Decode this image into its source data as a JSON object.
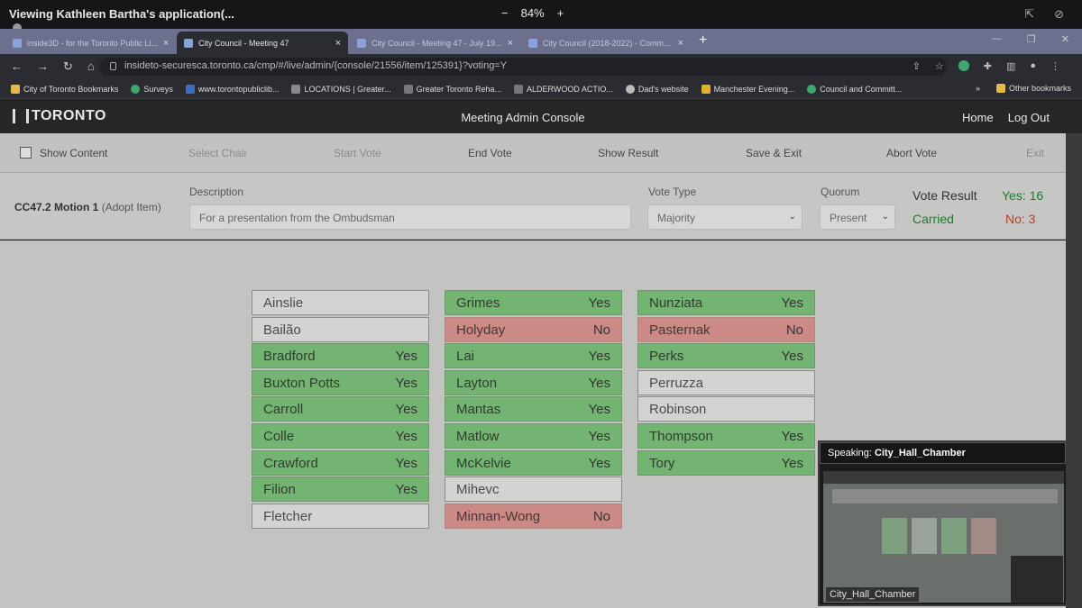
{
  "share": {
    "title": "Viewing Kathleen Bartha's application(...",
    "zoom": "84%",
    "zoom_minus": "−",
    "zoom_plus": "+"
  },
  "tabs": [
    {
      "label": "inside3D - for the Toronto Public Li...",
      "active": false
    },
    {
      "label": "City Council - Meeting 47",
      "active": true
    },
    {
      "label": "City Council - Meeting 47 - July 19...",
      "active": false
    },
    {
      "label": "City Council (2018-2022) - Comm...",
      "active": false
    }
  ],
  "browser": {
    "url": "insideto-securesca.toronto.ca/cmp/#/live/admin/{console/21556/item/125391}?voting=Y",
    "bookmarks": [
      "City of Toronto Bookmarks",
      "Surveys",
      "www.torontopubliclib...",
      "LOCATIONS | Greater...",
      "Greater Toronto Reha...",
      "ALDERWOOD ACTIO...",
      "Dad's website",
      "Manchester Evening...",
      "Council and Committ..."
    ],
    "other_bookmarks": "Other bookmarks",
    "more_bookmarks": "»"
  },
  "header": {
    "logo": "TORONTO",
    "title": "Meeting Admin Console",
    "home": "Home",
    "logout": "Log Out"
  },
  "toolbar": {
    "show_content": "Show Content",
    "select_chair": "Select Chair",
    "start_vote": "Start Vote",
    "end_vote": "End Vote",
    "show_result": "Show Result",
    "save_exit": "Save & Exit",
    "abort_vote": "Abort Vote",
    "exit": "Exit"
  },
  "motion": {
    "id": "CC47.2 Motion 1",
    "sub": "(Adopt Item)",
    "description_label": "Description",
    "description_value": "For a presentation from the Ombudsman",
    "vote_type_label": "Vote Type",
    "vote_type_value": "Majority",
    "quorum_label": "Quorum",
    "quorum_value": "Present",
    "result_label": "Vote Result",
    "result_status": "Carried",
    "yes_count": "Yes: 16",
    "no_count": "No: 3"
  },
  "votes": [
    [
      {
        "name": "Ainslie",
        "vote": ""
      },
      {
        "name": "Bailão",
        "vote": ""
      },
      {
        "name": "Bradford",
        "vote": "Yes"
      },
      {
        "name": "Buxton Potts",
        "vote": "Yes"
      },
      {
        "name": "Carroll",
        "vote": "Yes"
      },
      {
        "name": "Colle",
        "vote": "Yes"
      },
      {
        "name": "Crawford",
        "vote": "Yes"
      },
      {
        "name": "Filion",
        "vote": "Yes"
      },
      {
        "name": "Fletcher",
        "vote": ""
      }
    ],
    [
      {
        "name": "Grimes",
        "vote": "Yes"
      },
      {
        "name": "Holyday",
        "vote": "No"
      },
      {
        "name": "Lai",
        "vote": "Yes"
      },
      {
        "name": "Layton",
        "vote": "Yes"
      },
      {
        "name": "Mantas",
        "vote": "Yes"
      },
      {
        "name": "Matlow",
        "vote": "Yes"
      },
      {
        "name": "McKelvie",
        "vote": "Yes"
      },
      {
        "name": "Mihevc",
        "vote": ""
      },
      {
        "name": "Minnan-Wong",
        "vote": "No"
      }
    ],
    [
      {
        "name": "Nunziata",
        "vote": "Yes"
      },
      {
        "name": "Pasternak",
        "vote": "No"
      },
      {
        "name": "Perks",
        "vote": "Yes"
      },
      {
        "name": "Perruzza",
        "vote": ""
      },
      {
        "name": "Robinson",
        "vote": ""
      },
      {
        "name": "Thompson",
        "vote": "Yes"
      },
      {
        "name": "Tory",
        "vote": "Yes"
      }
    ]
  ],
  "speaker": {
    "prefix": "Speaking:",
    "name": "City_Hall_Chamber",
    "label": "City_Hall_Chamber"
  },
  "colors": {
    "yes": "#73b472",
    "no": "#cc8a86",
    "carried": "#1e7a2e",
    "no_count": "#c0392b"
  }
}
